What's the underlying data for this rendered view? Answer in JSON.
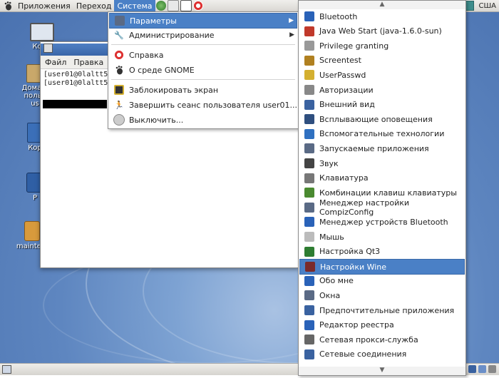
{
  "top_panel": {
    "applications": "Приложения",
    "places": "Переход",
    "system": "Система",
    "keyboard_layout": "США"
  },
  "system_menu": {
    "items": [
      {
        "label": "Параметры",
        "icon": "preferences-icon",
        "submenu": true,
        "highlighted": true
      },
      {
        "label": "Администрирование",
        "icon": "administration-icon",
        "submenu": true
      },
      {
        "label": "Справка",
        "icon": "help-lifebuoy-icon"
      },
      {
        "label": "О среде GNOME",
        "icon": "gnome-foot-icon"
      },
      {
        "label": "Заблокировать экран",
        "icon": "lock-screen-icon"
      },
      {
        "label": "Завершить сеанс пользователя user01...",
        "icon": "logout-icon"
      },
      {
        "label": "Выключить...",
        "icon": "power-icon"
      }
    ]
  },
  "prefs_menu": {
    "items": [
      {
        "label": "Bluetooth",
        "icon": "bluetooth-icon",
        "color": "#2a62b8"
      },
      {
        "label": "Java Web Start (java-1.6.0-sun)",
        "icon": "java-icon",
        "color": "#c0392b"
      },
      {
        "label": "Privilege granting",
        "icon": "privilege-icon",
        "color": "#999999"
      },
      {
        "label": "Screentest",
        "icon": "screentest-icon",
        "color": "#b08020"
      },
      {
        "label": "UserPasswd",
        "icon": "keys-icon",
        "color": "#d4b030"
      },
      {
        "label": "Авторизации",
        "icon": "authorizations-icon",
        "color": "#888888"
      },
      {
        "label": "Внешний вид",
        "icon": "appearance-icon",
        "color": "#3a62a0"
      },
      {
        "label": "Всплывающие оповещения",
        "icon": "notifications-icon",
        "color": "#2f4f7f"
      },
      {
        "label": "Вспомогательные технологии",
        "icon": "accessibility-icon",
        "color": "#2f70c0"
      },
      {
        "label": "Запускаемые приложения",
        "icon": "startup-apps-icon",
        "color": "#5a6a85"
      },
      {
        "label": "Звук",
        "icon": "sound-icon",
        "color": "#444444"
      },
      {
        "label": "Клавиатура",
        "icon": "keyboard-icon",
        "color": "#777777"
      },
      {
        "label": "Комбинации клавиш клавиатуры",
        "icon": "keyboard-shortcuts-icon",
        "color": "#4a8a30"
      },
      {
        "label": "Менеджер настройки CompizConfig",
        "icon": "compizconfig-icon",
        "color": "#5a6a85"
      },
      {
        "label": "Менеджер устройств Bluetooth",
        "icon": "bluetooth-manager-icon",
        "color": "#2a62b8"
      },
      {
        "label": "Мышь",
        "icon": "mouse-icon",
        "color": "#bbbbbb"
      },
      {
        "label": "Настройка Qt3",
        "icon": "qt3-icon",
        "color": "#2e7d32"
      },
      {
        "label": "Настройки Wine",
        "icon": "wine-icon",
        "color": "#7a2a2a",
        "highlighted": true
      },
      {
        "label": "Обо мне",
        "icon": "about-me-icon",
        "color": "#2a62b8"
      },
      {
        "label": "Окна",
        "icon": "windows-icon",
        "color": "#5a6a85"
      },
      {
        "label": "Предпочтительные приложения",
        "icon": "preferred-apps-icon",
        "color": "#3a62a0"
      },
      {
        "label": "Редактор реестра",
        "icon": "registry-editor-icon",
        "color": "#2a62b8"
      },
      {
        "label": "Сетевая прокси-служба",
        "icon": "network-proxy-icon",
        "color": "#666666"
      },
      {
        "label": "Сетевые соединения",
        "icon": "network-connections-icon",
        "color": "#3a62a0"
      }
    ]
  },
  "terminal": {
    "menu": [
      "Файл",
      "Правка"
    ],
    "lines": [
      "[user01@0laltt5gr",
      "[user01@0laltt5gr"
    ]
  },
  "desktop_icons": [
    {
      "label": "Компьютер",
      "visible_label": "Комп",
      "icon": "computer-icon"
    },
    {
      "label": "Домашняя папка",
      "visible_label": "Домаш\nполь\nus",
      "icon": "home-folder-icon"
    },
    {
      "label": "Корзина",
      "visible_label": "Кор",
      "icon": "trash-icon"
    },
    {
      "label": "P",
      "visible_label": "P",
      "icon": "drive-icon"
    },
    {
      "label": "maintest",
      "visible_label": "maintest",
      "icon": "package-icon"
    }
  ],
  "colors": {
    "highlight": "#4a80c6",
    "panel": "#e4e2dd"
  }
}
